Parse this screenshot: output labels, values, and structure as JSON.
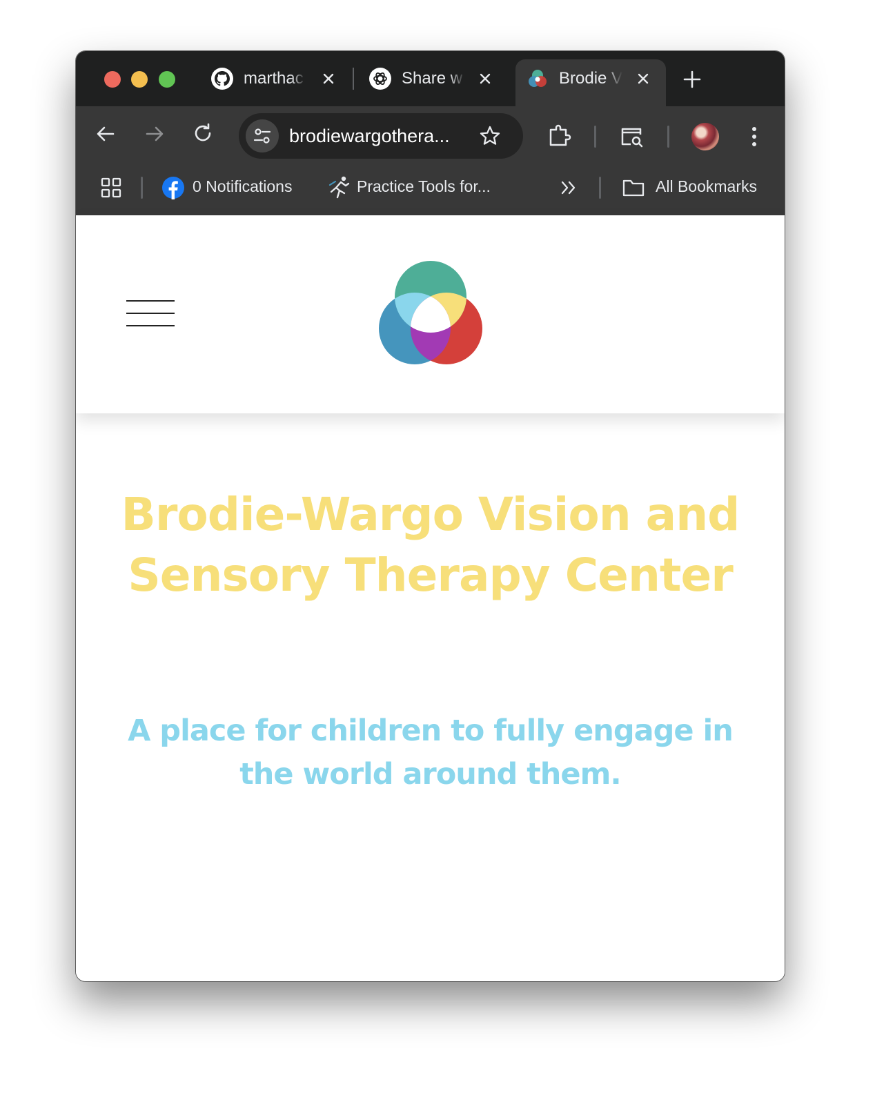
{
  "browser": {
    "tabs": [
      {
        "title": "marthac",
        "icon": "github-icon",
        "active": false
      },
      {
        "title": "Share w",
        "icon": "openai-icon",
        "active": false
      },
      {
        "title": "Brodie V",
        "icon": "site-logo-icon",
        "active": true
      }
    ],
    "url": "brodiewargothera...",
    "bookmarks": [
      {
        "label": "0 Notifications",
        "icon": "facebook-icon"
      },
      {
        "label": "Practice Tools for...",
        "icon": "runner-icon"
      }
    ],
    "all_bookmarks_label": "All Bookmarks"
  },
  "page": {
    "title": "Brodie-Wargo Vision and Sensory Therapy Center",
    "subtitle": "A place for children to fully engage in the world around them."
  },
  "colors": {
    "title": "#f7df7a",
    "subtitle": "#8ad6ec",
    "logo_teal": "#4eae97",
    "logo_blue": "#4595bd",
    "logo_red": "#d4403a",
    "logo_light_blue": "#8ad6ec",
    "logo_yellow": "#f7df7a",
    "logo_purple": "#a23ab4"
  }
}
